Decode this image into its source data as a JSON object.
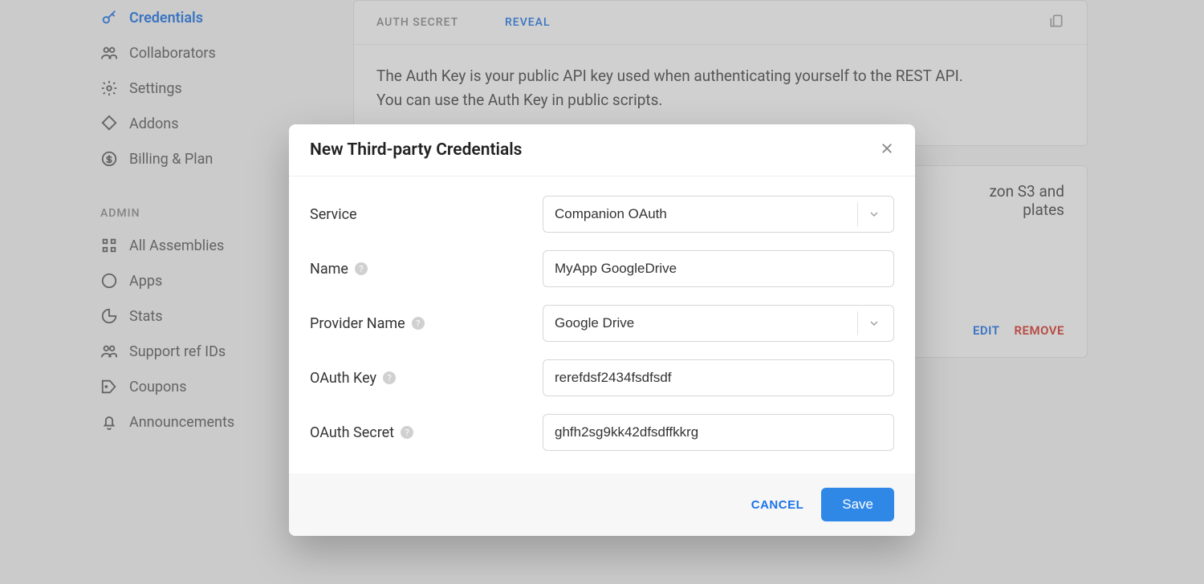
{
  "sidebar": {
    "items": [
      {
        "label": "Credentials",
        "active": true
      },
      {
        "label": "Collaborators"
      },
      {
        "label": "Settings"
      },
      {
        "label": "Addons"
      },
      {
        "label": "Billing & Plan"
      }
    ],
    "admin_label": "ADMIN",
    "admin_items": [
      {
        "label": "All Assemblies"
      },
      {
        "label": "Apps"
      },
      {
        "label": "Stats"
      },
      {
        "label": "Support ref IDs"
      },
      {
        "label": "Coupons"
      },
      {
        "label": "Announcements"
      }
    ]
  },
  "auth_card": {
    "secret_label": "AUTH SECRET",
    "reveal": "REVEAL",
    "desc": "The Auth Key is your public API key used when authenticating yourself to the REST API. You can use the Auth Key in public scripts."
  },
  "third_card": {
    "partial_text_1": "zon S3 and",
    "partial_text_2": "plates",
    "edit": "EDIT",
    "remove": "REMOVE"
  },
  "modal": {
    "title": "New Third-party Credentials",
    "labels": {
      "service": "Service",
      "name": "Name",
      "provider": "Provider Name",
      "oauth_key": "OAuth Key",
      "oauth_secret": "OAuth Secret"
    },
    "values": {
      "service": "Companion OAuth",
      "name": "MyApp GoogleDrive",
      "provider": "Google Drive",
      "oauth_key": "rerefdsf2434fsdfsdf",
      "oauth_secret": "ghfh2sg9kk42dfsdffkkrg"
    },
    "cancel": "CANCEL",
    "save": "Save"
  }
}
